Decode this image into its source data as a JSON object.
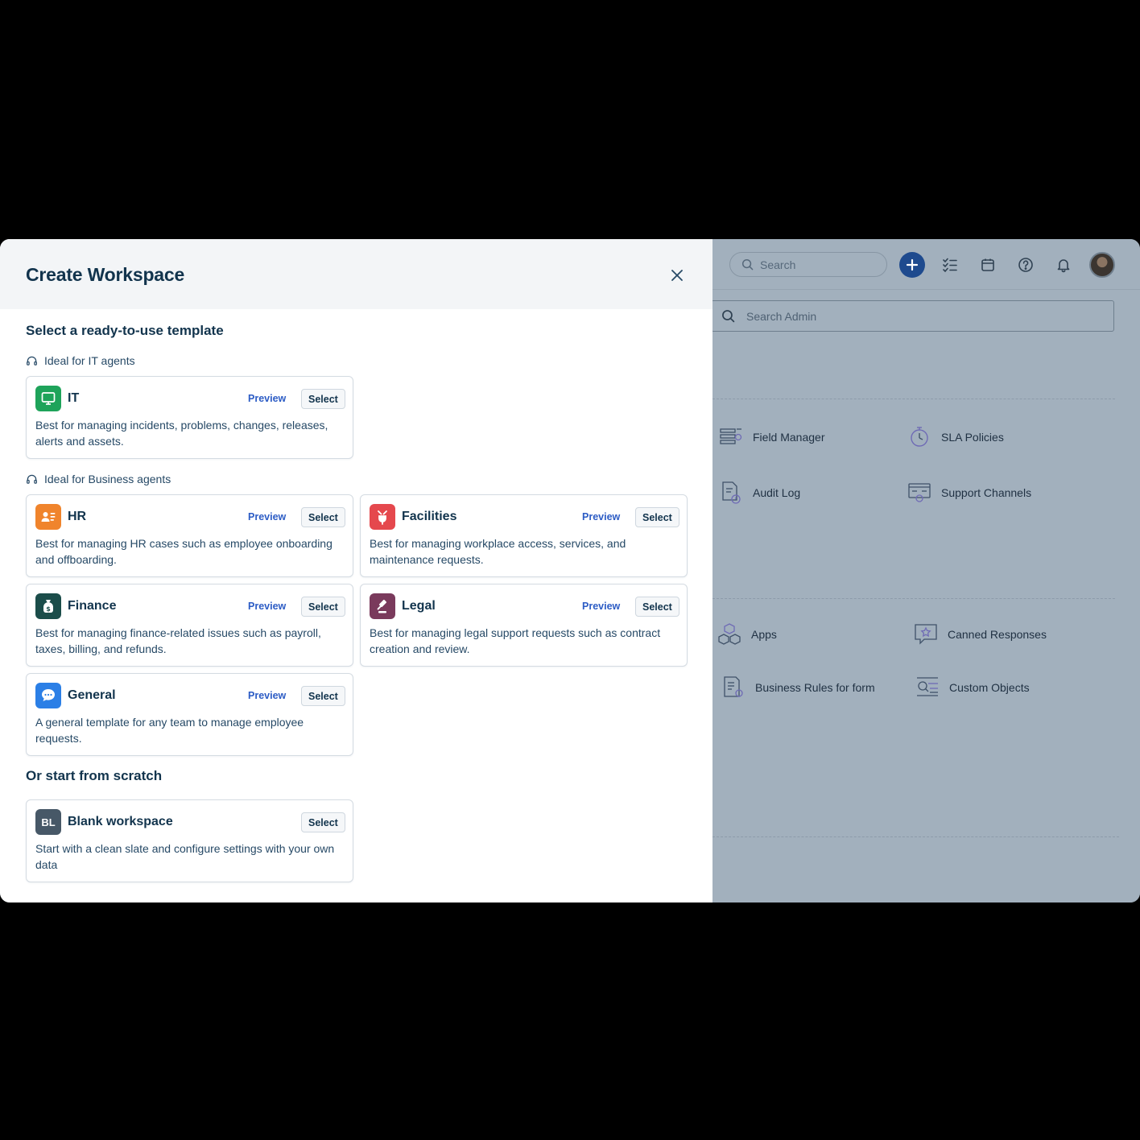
{
  "modal": {
    "title": "Create Workspace",
    "section_templates": "Select a ready-to-use template",
    "group_it": "Ideal for IT agents",
    "group_business": "Ideal for Business agents",
    "section_scratch": "Or start from scratch",
    "preview_label": "Preview",
    "select_label": "Select",
    "templates": {
      "it": {
        "name": "IT",
        "description": "Best for managing incidents, problems, changes, releases, alerts and assets.",
        "color": "#1ea35a"
      },
      "hr": {
        "name": "HR",
        "description": "Best for managing HR cases such as employee onboarding and offboarding.",
        "color": "#f0842c"
      },
      "facilities": {
        "name": "Facilities",
        "description": "Best for managing workplace access, services, and maintenance requests.",
        "color": "#e5484d"
      },
      "finance": {
        "name": "Finance",
        "description": "Best for managing finance-related issues such as payroll, taxes, billing, and refunds.",
        "color": "#1b4d4a"
      },
      "legal": {
        "name": "Legal",
        "description": "Best for managing legal support requests such as contract creation and review.",
        "color": "#7a3a5c"
      },
      "general": {
        "name": "General",
        "description": "A general template for any team to manage employee requests.",
        "color": "#2b7fe6"
      },
      "blank": {
        "name": "Blank workspace",
        "initials": "BL",
        "description": "Start with a clean slate and configure settings with your own data",
        "color": "#475867"
      }
    }
  },
  "background": {
    "search_placeholder": "Search",
    "admin_search_placeholder": "Search Admin",
    "items": {
      "field_manager": "Field Manager",
      "sla_policies": "SLA Policies",
      "audit_log": "Audit Log",
      "support_channels": "Support Channels",
      "apps": "Apps",
      "canned_responses": "Canned Responses",
      "business_rules": "Business Rules for form",
      "custom_objects": "Custom Objects"
    }
  }
}
